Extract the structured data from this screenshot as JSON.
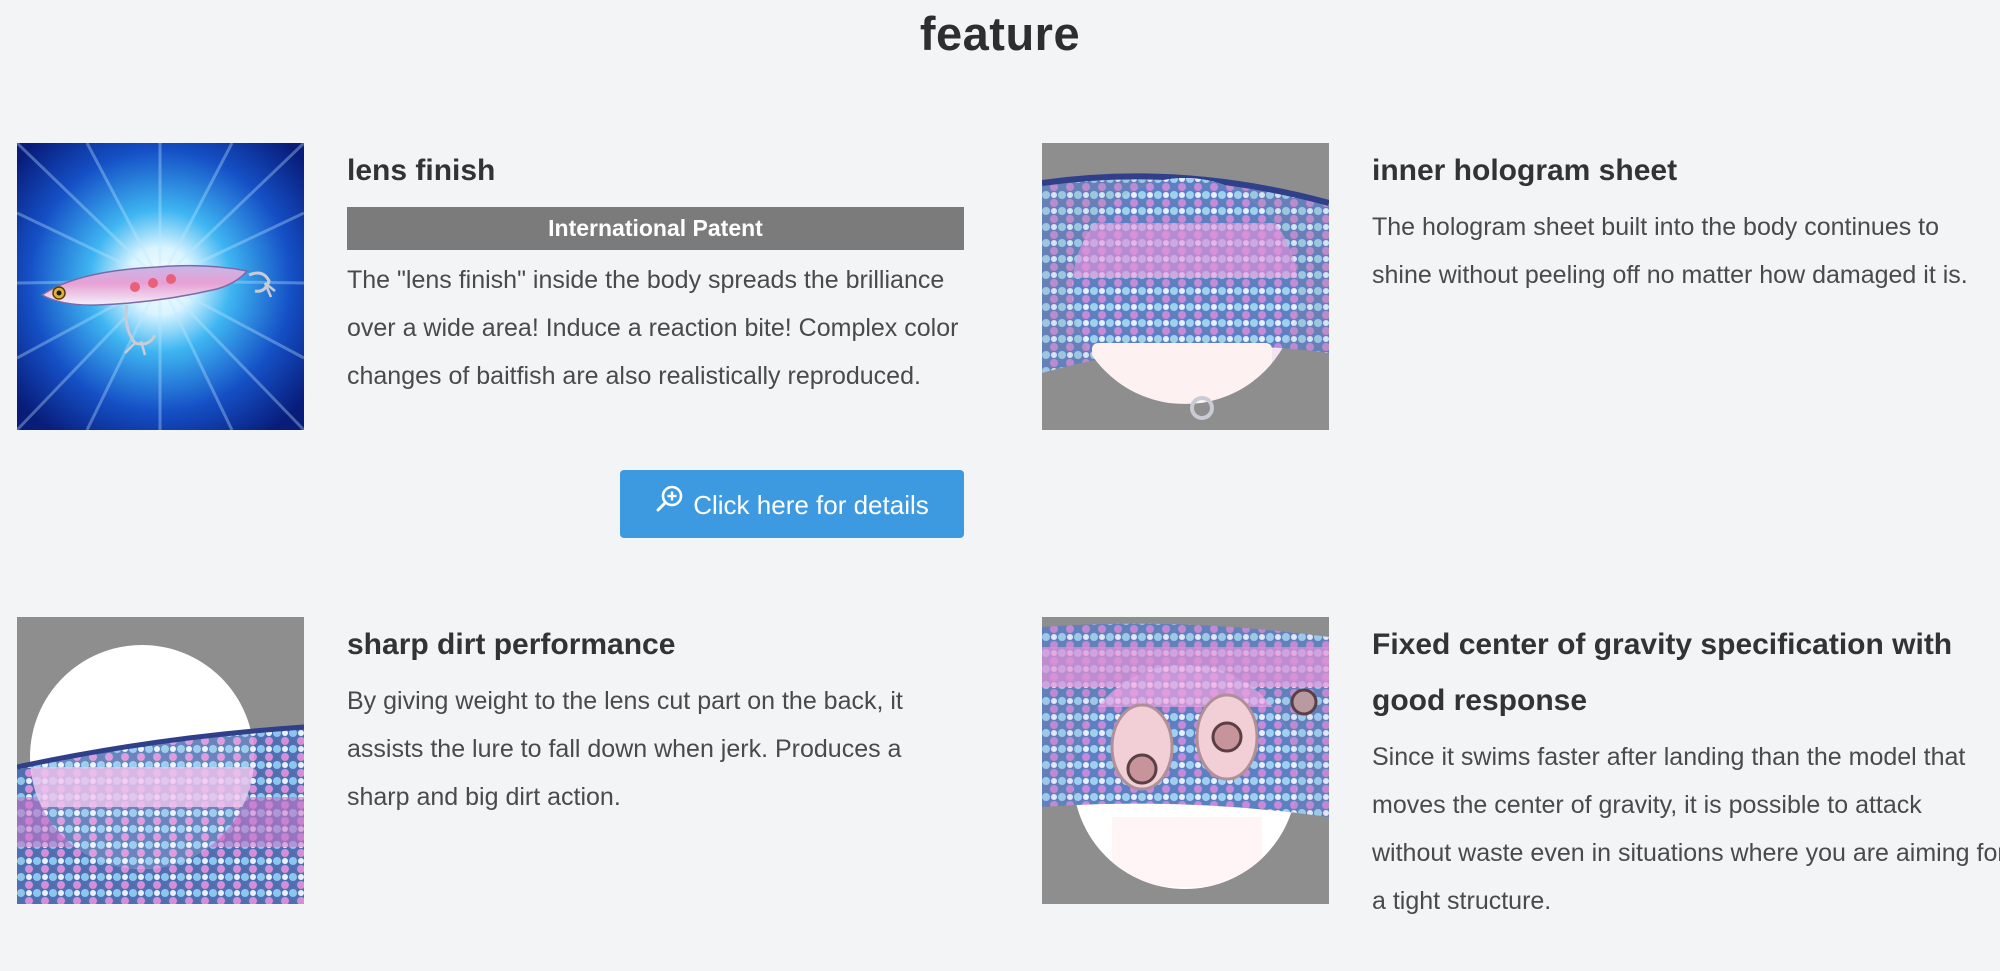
{
  "section": {
    "title": "feature"
  },
  "features": [
    {
      "title": "lens finish",
      "badge": "International Patent",
      "text": "The \"lens finish\" inside the body spreads the brilliance over a wide area! Induce a reaction bite! Complex color changes of baitfish are also realistically reproduced.",
      "button_label": "Click here for details"
    },
    {
      "title": "inner hologram sheet",
      "text": "The hologram sheet built into the body continues to shine without peeling off no matter how damaged it is."
    },
    {
      "title": "sharp dirt performance",
      "text": "By giving weight to the lens cut part on the back, it assists the lure to fall down when jerk. Produces a sharp and big dirt action."
    },
    {
      "title": "Fixed center of gravity specification with good response",
      "text": "Since it swims faster after landing than the model that moves the center of gravity, it is possible to attack without waste even in situations where you are aiming for a tight structure."
    }
  ],
  "colors": {
    "background": "#f3f4f6",
    "badge": "#7b7b7b",
    "button": "#3d9ae0",
    "thumb_backdrop": "#8e8e8e"
  },
  "icons": {
    "button": "zoom-in-icon"
  }
}
